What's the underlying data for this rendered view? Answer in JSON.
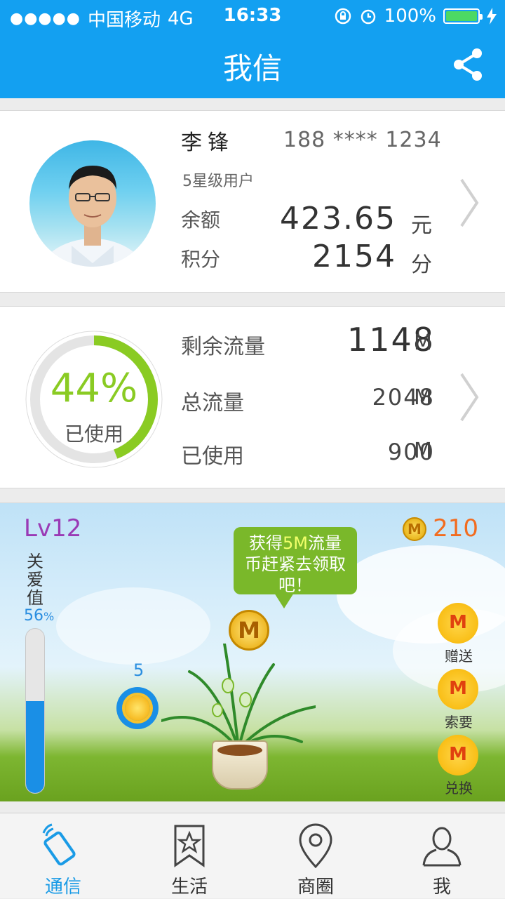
{
  "status_bar": {
    "signal_dots": "●●●●●",
    "carrier": "中国移动",
    "network": "4G",
    "time": "16:33",
    "battery_pct": "100%"
  },
  "header": {
    "title": "我信",
    "share_icon": "share-icon"
  },
  "profile": {
    "name": "李锋",
    "phone": "188 **** 1234",
    "level": "5星级用户",
    "balance_label": "余额",
    "balance_value": "423.65",
    "balance_unit": "元",
    "points_label": "积分",
    "points_value": "2154",
    "points_unit": "分"
  },
  "data_usage": {
    "used_percent_text": "44%",
    "used_fraction": 0.44,
    "ring_label": "已使用",
    "remaining_label": "剩余流量",
    "remaining_value": "1148",
    "total_label": "总流量",
    "total_value": "2048",
    "used_label": "已使用",
    "used_value": "900",
    "unit": "M"
  },
  "garden": {
    "level": "Lv12",
    "coins": "210",
    "coin_glyph": "M",
    "love_label": "关爱值",
    "love_percent_text": "56",
    "love_percent_sign": "%",
    "love_fraction": 0.56,
    "bubble_prefix": "获得",
    "bubble_highlight": "5M",
    "bubble_suffix": "流量币赶紧去领取吧！",
    "sun_count": "5",
    "actions": [
      {
        "label": "赠送",
        "icon": "gift-coin-icon"
      },
      {
        "label": "索要",
        "icon": "request-coin-icon"
      },
      {
        "label": "兑换",
        "icon": "exchange-coin-icon"
      }
    ]
  },
  "tabs": [
    {
      "label": "通信",
      "icon": "phone-icon",
      "active": true
    },
    {
      "label": "生活",
      "icon": "bookmark-star-icon",
      "active": false
    },
    {
      "label": "商圈",
      "icon": "location-pin-icon",
      "active": false
    },
    {
      "label": "我",
      "icon": "user-icon",
      "active": false
    }
  ],
  "colors": {
    "accent": "#13a0f1",
    "ring_green": "#8acb23",
    "coin_orange": "#f26c1f",
    "level_purple": "#9a3ab5"
  }
}
